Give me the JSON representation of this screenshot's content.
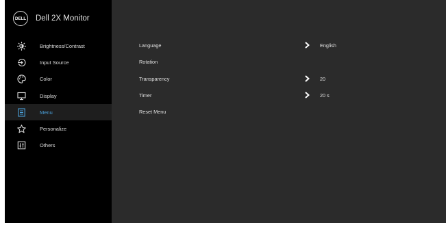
{
  "app": {
    "title": "Dell 2X Monitor",
    "logo_text": "DELL"
  },
  "sidebar": {
    "items": [
      {
        "label": "Brightness/Contrast",
        "icon": "brightness-icon"
      },
      {
        "label": "Input Source",
        "icon": "input-source-icon"
      },
      {
        "label": "Color",
        "icon": "color-palette-icon"
      },
      {
        "label": "Display",
        "icon": "display-icon"
      },
      {
        "label": "Menu",
        "icon": "menu-icon",
        "active": true
      },
      {
        "label": "Personalize",
        "icon": "star-icon"
      },
      {
        "label": "Others",
        "icon": "others-icon"
      }
    ]
  },
  "menu_settings": {
    "rows": [
      {
        "label": "Language",
        "value": "English",
        "has_submenu": true
      },
      {
        "label": "Rotation",
        "value": "",
        "has_submenu": false
      },
      {
        "label": "Transparency",
        "value": "20",
        "has_submenu": true
      },
      {
        "label": "Timer",
        "value": "20 s",
        "has_submenu": true
      },
      {
        "label": "Reset Menu",
        "value": "",
        "has_submenu": false
      }
    ]
  },
  "colors": {
    "accent": "#4a9fd8",
    "sidebar_bg": "#000000",
    "content_bg": "#2b2b2b"
  }
}
